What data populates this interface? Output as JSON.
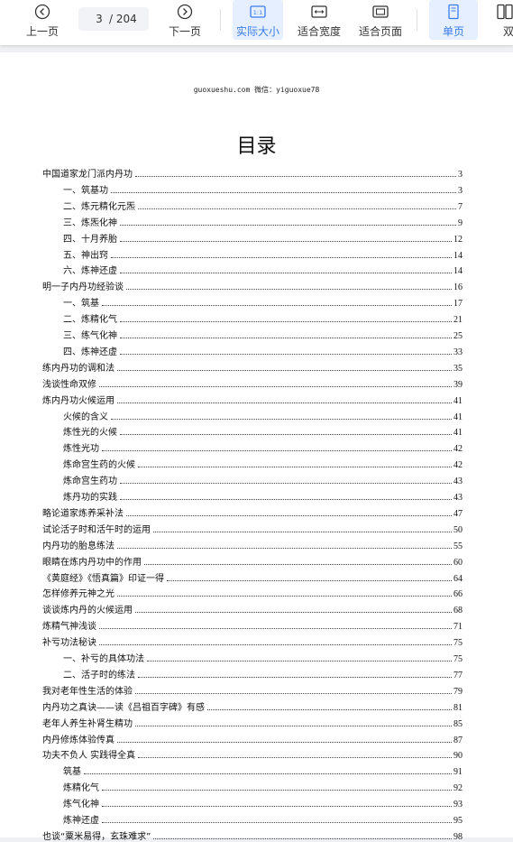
{
  "toolbar": {
    "prev_label": "上一页",
    "next_label": "下一页",
    "current_page": "3",
    "total_pages": "/ 204",
    "actual_size_label": "实际大小",
    "actual_size_icon_text": "1:1",
    "fit_width_label": "适合宽度",
    "fit_page_label": "适合页面",
    "single_page_label": "单页",
    "double_page_label": "双"
  },
  "document": {
    "header": "guoxueshu.com  微信：yiguoxue78",
    "title": "目录",
    "toc": [
      {
        "text": "中国道家龙门派内丹功",
        "page": "3",
        "level": 0
      },
      {
        "text": "一、筑基功",
        "page": "3",
        "level": 1
      },
      {
        "text": "二、炼元精化元炁",
        "page": "7",
        "level": 1
      },
      {
        "text": "三、炼炁化神",
        "page": "9",
        "level": 1
      },
      {
        "text": "四、十月养胎",
        "page": "12",
        "level": 1
      },
      {
        "text": "五、神出窍",
        "page": "14",
        "level": 1
      },
      {
        "text": "六、炼神还虚",
        "page": "14",
        "level": 1
      },
      {
        "text": "明一子内丹功经验谈",
        "page": "16",
        "level": 0
      },
      {
        "text": "一、筑基",
        "page": "17",
        "level": 1
      },
      {
        "text": "二、炼精化气",
        "page": "21",
        "level": 1
      },
      {
        "text": "三、练气化神",
        "page": "25",
        "level": 1
      },
      {
        "text": "四、炼神还虚",
        "page": "33",
        "level": 1
      },
      {
        "text": "练内丹功的调和法",
        "page": "35",
        "level": 0
      },
      {
        "text": "浅谈性命双修",
        "page": "39",
        "level": 0
      },
      {
        "text": "炼内丹功火候运用",
        "page": "41",
        "level": 0
      },
      {
        "text": "火候的含义",
        "page": "41",
        "level": 1
      },
      {
        "text": "炼性光的火候",
        "page": "41",
        "level": 1
      },
      {
        "text": "炼性光功",
        "page": "42",
        "level": 1
      },
      {
        "text": "炼命宫生药的火候",
        "page": "42",
        "level": 1
      },
      {
        "text": "炼命宫生药功",
        "page": "43",
        "level": 1
      },
      {
        "text": "炼丹功的实践",
        "page": "43",
        "level": 1
      },
      {
        "text": "略论道家炼养采补法",
        "page": "47",
        "level": 0
      },
      {
        "text": "试论活子时和活午时的运用",
        "page": "50",
        "level": 0
      },
      {
        "text": "内丹功的胎息练法",
        "page": "55",
        "level": 0
      },
      {
        "text": "眼睛在炼内丹功中的作用",
        "page": "60",
        "level": 0
      },
      {
        "text": "《黄庭经》《悟真篇》印证一得",
        "page": "64",
        "level": 0
      },
      {
        "text": "怎样修养元神之光",
        "page": "66",
        "level": 0
      },
      {
        "text": "谈谈炼内丹的火候运用",
        "page": "68",
        "level": 0
      },
      {
        "text": "炼精气神浅谈",
        "page": "71",
        "level": 0
      },
      {
        "text": "补亏功法秘诀",
        "page": "75",
        "level": 0
      },
      {
        "text": "一、补亏的具体功法",
        "page": "75",
        "level": 1
      },
      {
        "text": "二、活子时的练法",
        "page": "77",
        "level": 1
      },
      {
        "text": "我对老年性生活的体验",
        "page": "79",
        "level": 0
      },
      {
        "text": "内丹功之真诀——读《吕祖百字碑》有感",
        "page": "81",
        "level": 0
      },
      {
        "text": "老年人养生补肾生精功",
        "page": "85",
        "level": 0
      },
      {
        "text": "内丹修炼体验传真",
        "page": "87",
        "level": 0
      },
      {
        "text": "功夫不负人  实践得全真",
        "page": "90",
        "level": 0
      },
      {
        "text": "筑基",
        "page": "91",
        "level": 1
      },
      {
        "text": "炼精化气",
        "page": "92",
        "level": 1
      },
      {
        "text": "炼气化神",
        "page": "93",
        "level": 1
      },
      {
        "text": "炼神还虚",
        "page": "95",
        "level": 1
      },
      {
        "text": "也谈“粟米易得，玄珠难求”",
        "page": "98",
        "level": 0
      }
    ]
  }
}
